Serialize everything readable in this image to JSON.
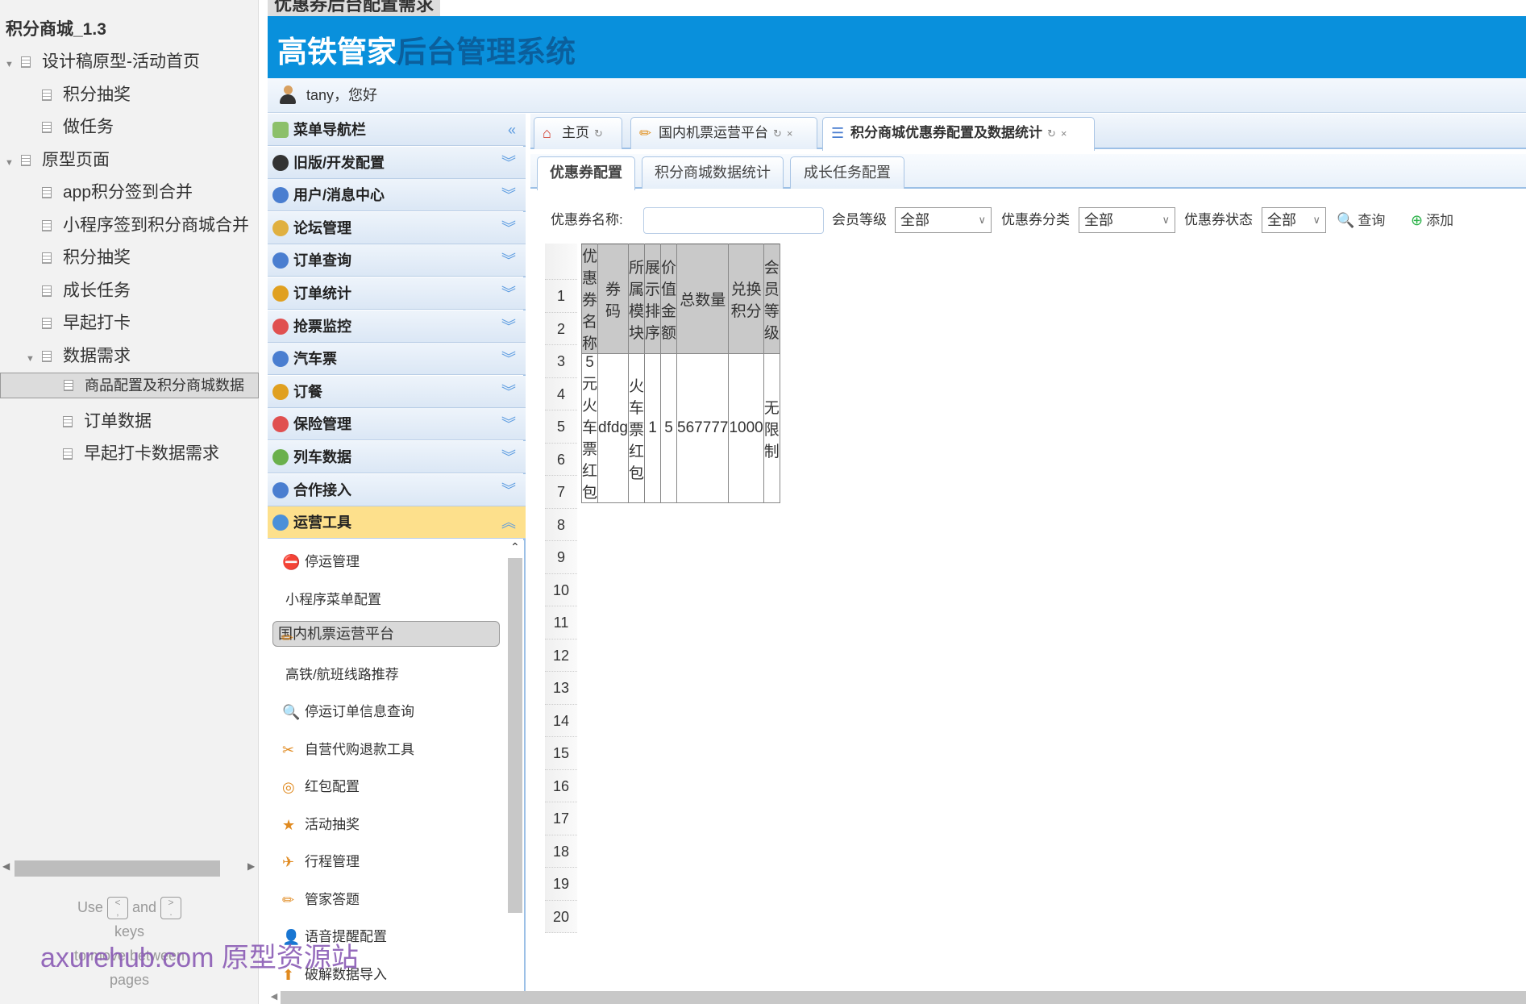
{
  "sidebar": {
    "project": "积分商城_1.3",
    "items": [
      {
        "label": "设计稿原型-活动首页",
        "level": 0,
        "expanded": true
      },
      {
        "label": "积分抽奖",
        "level": 1
      },
      {
        "label": "做任务",
        "level": 1
      },
      {
        "label": "原型页面",
        "level": 0,
        "expanded": true
      },
      {
        "label": "app积分签到合并",
        "level": 1
      },
      {
        "label": "小程序签到积分商城合并",
        "level": 1
      },
      {
        "label": "积分抽奖",
        "level": 1
      },
      {
        "label": "成长任务",
        "level": 1
      },
      {
        "label": "早起打卡",
        "level": 1
      },
      {
        "label": "数据需求",
        "level": 1,
        "expanded": true
      },
      {
        "label": "商品配置及积分商城数据",
        "level": 2,
        "selected": true
      },
      {
        "label": "订单数据",
        "level": 2
      },
      {
        "label": "早起打卡数据需求",
        "level": 2
      }
    ],
    "hint": {
      "use": "Use",
      "and": "and",
      "keys": "keys",
      "move": "to move between",
      "pages": "pages",
      "key1": "<\n,",
      "key2": ">\n."
    }
  },
  "watermark": "axurehub.com 原型资源站",
  "page_title": "优惠券后台配置需求",
  "app": {
    "title_a": "高铁管家",
    "title_b": "后台管理系统",
    "greeting": "tany，您好"
  },
  "menu": {
    "header": "菜单导航栏",
    "items": [
      "旧版/开发配置",
      "用户/消息中心",
      "论坛管理",
      "订单查询",
      "订单统计",
      "抢票监控",
      "汽车票",
      "订餐",
      "保险管理",
      "列车数据",
      "合作接入"
    ],
    "open": "运营工具",
    "sub": [
      {
        "label": "停运管理",
        "icon": "⛔"
      },
      {
        "label": "小程序菜单配置",
        "icon": ""
      },
      {
        "label": "国内机票运营平台",
        "icon": "✏",
        "selected": true
      },
      {
        "label": "高铁/航班线路推荐",
        "icon": ""
      },
      {
        "label": "停运订单信息查询",
        "icon": "🔍"
      },
      {
        "label": "自营代购退款工具",
        "icon": "✂"
      },
      {
        "label": "红包配置",
        "icon": "◎"
      },
      {
        "label": "活动抽奖",
        "icon": "★"
      },
      {
        "label": "行程管理",
        "icon": "✈"
      },
      {
        "label": "管家答题",
        "icon": "✏"
      },
      {
        "label": "语音提醒配置",
        "icon": "👤"
      },
      {
        "label": "破解数据导入",
        "icon": "⬆"
      }
    ]
  },
  "tabs": [
    {
      "label": "主页"
    },
    {
      "label": "国内机票运营平台"
    },
    {
      "label": "积分商城优惠券配置及数据统计",
      "active": true
    }
  ],
  "subtabs": [
    {
      "label": "优惠券配置",
      "active": true
    },
    {
      "label": "积分商城数据统计"
    },
    {
      "label": "成长任务配置"
    }
  ],
  "filters": {
    "name_label": "优惠券名称:",
    "name_value": "",
    "level_label": "会员等级",
    "level_value": "全部",
    "cat_label": "优惠券分类",
    "cat_value": "全部",
    "status_label": "优惠券状态",
    "status_value": "全部",
    "query": "查询",
    "add": "添加"
  },
  "table": {
    "columns": [
      "优惠券名称",
      "券码",
      "所属模块",
      "展示排序",
      "价值金额",
      "总数量",
      "兑换积分",
      "会员等级"
    ],
    "rows": [
      [
        "5元火车票红包",
        "dfdg",
        "火车票红包",
        "1",
        "5",
        "567777",
        "1000",
        "无限制"
      ]
    ],
    "row_numbers": [
      "1",
      "2",
      "3",
      "4",
      "5",
      "6",
      "7",
      "8",
      "9",
      "10",
      "11",
      "12",
      "13",
      "14",
      "15",
      "16",
      "17",
      "18",
      "19",
      "20"
    ]
  }
}
